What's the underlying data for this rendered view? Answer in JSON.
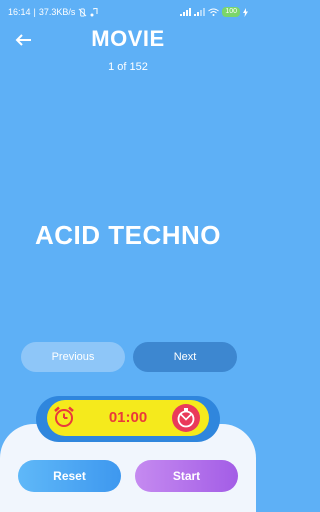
{
  "status": {
    "time": "16:14",
    "speed": "37.3KB/s",
    "battery": "100"
  },
  "header": {
    "title": "MOVIE",
    "counter": "1 of 152"
  },
  "card": {
    "word": "ACID TECHNO"
  },
  "nav": {
    "previous": "Previous",
    "next": "Next"
  },
  "timer": {
    "value": "01:00"
  },
  "actions": {
    "reset": "Reset",
    "start": "Start"
  },
  "colors": {
    "background": "#5eb0f6",
    "timer_pill": "#f5ea1c",
    "timer_text": "#ea3a3a"
  }
}
